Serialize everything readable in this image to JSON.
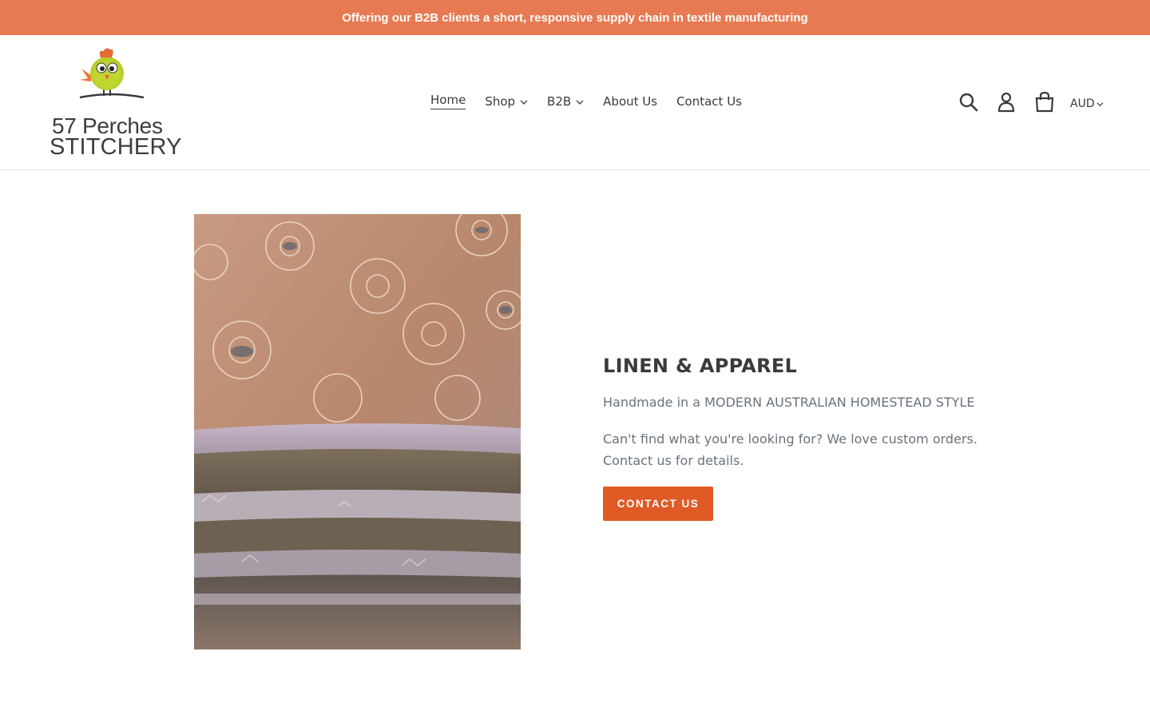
{
  "announcement": {
    "text": "Offering our B2B clients a short, responsive supply chain in textile manufacturing"
  },
  "logo": {
    "line1": "57 Perches",
    "line2": "STITCHERY",
    "icon": "chick-mascot-icon"
  },
  "nav": {
    "items": [
      {
        "label": "Home",
        "active": true
      },
      {
        "label": "Shop",
        "has_dropdown": true
      },
      {
        "label": "B2B",
        "has_dropdown": true
      },
      {
        "label": "About Us"
      },
      {
        "label": "Contact Us"
      }
    ]
  },
  "header_icons": {
    "search": "search-icon",
    "account": "user-icon",
    "cart": "cart-icon",
    "currency": "AUD"
  },
  "hero": {
    "image": "embroidered-linen-stack-photo",
    "title": "LINEN & APPAREL",
    "subtitle": "Handmade in a MODERN AUSTRALIAN HOMESTEAD STYLE",
    "description": "Can't find what you're looking for? We love custom orders. Contact us for details.",
    "button_label": "CONTACT US"
  },
  "colors": {
    "announcement_bg": "#e77a52",
    "button_bg": "#e05a25",
    "text_dark": "#3a3a3a",
    "text_muted": "#69727b"
  }
}
